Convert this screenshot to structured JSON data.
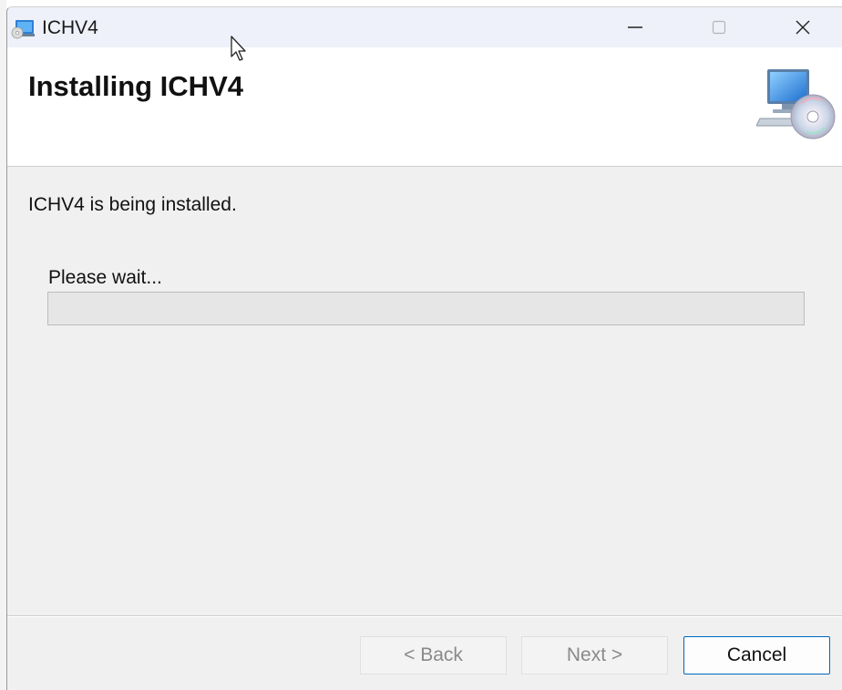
{
  "window": {
    "title": "ICHV4",
    "minimize_glyph": "—",
    "close_glyph": "✕"
  },
  "banner": {
    "heading": "Installing ICHV4",
    "icon": "computer-cd-icon"
  },
  "main": {
    "status": "ICHV4 is being installed.",
    "wait_label": "Please wait...",
    "progress": 0
  },
  "footer": {
    "back_label": "< Back",
    "next_label": "Next >",
    "cancel_label": "Cancel"
  },
  "colors": {
    "accent": "#0067c0",
    "titlebar": "#eef1f9",
    "progress_track": "#e6e6e6",
    "progress_fill": "#06b025"
  },
  "icons": {
    "app": "installer-app-icon",
    "cursor": "mouse-pointer-icon"
  }
}
